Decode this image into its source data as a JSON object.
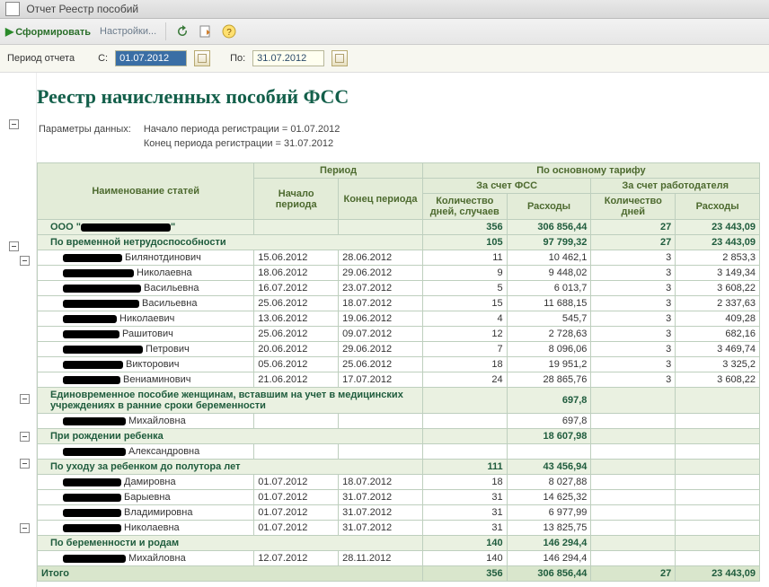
{
  "window": {
    "title": "Отчет  Реестр пособий"
  },
  "toolbar": {
    "generate": "Сформировать",
    "settings": "Настройки..."
  },
  "filter": {
    "period_label": "Период отчета",
    "from_label": "С:",
    "from_value": "01.07.2012",
    "to_label": "По:",
    "to_value": "31.07.2012"
  },
  "header": {
    "title": "Реестр начисленных пособий ФСС",
    "params_label": "Параметры данных:",
    "p1": "Начало периода регистрации = 01.07.2012",
    "p2": "Конец периода регистрации = 31.07.2012"
  },
  "cols": {
    "name": "Наименование статей",
    "period": "Период",
    "start": "Начало периода",
    "end": "Конец периода",
    "main_tariff": "По основному тарифу",
    "fss": "За счет ФСС",
    "employer": "За счет работодателя",
    "days": "Количество дней, случаев",
    "days2": "Количество дней",
    "exp": "Расходы"
  },
  "org_prefix": "ООО \"",
  "org_suffix": "\"",
  "org_total": {
    "fss_days": "356",
    "fss_exp": "306 856,44",
    "emp_days": "27",
    "emp_exp": "23 443,09"
  },
  "cat1": {
    "name": "По временной нетрудоспособности",
    "fss_days": "105",
    "fss_exp": "97 799,32",
    "emp_days": "27",
    "emp_exp": "23 443,09"
  },
  "rows1": [
    {
      "name": " Билянотдинович",
      "start": "15.06.2012",
      "end": "28.06.2012",
      "fd": "11",
      "fe": "10 462,1",
      "ed": "3",
      "ee": "2 853,3"
    },
    {
      "name": " Николаевна",
      "start": "18.06.2012",
      "end": "29.06.2012",
      "fd": "9",
      "fe": "9 448,02",
      "ed": "3",
      "ee": "3 149,34"
    },
    {
      "name": " Васильевна",
      "start": "16.07.2012",
      "end": "23.07.2012",
      "fd": "5",
      "fe": "6 013,7",
      "ed": "3",
      "ee": "3 608,22"
    },
    {
      "name": " Васильевна",
      "start": "25.06.2012",
      "end": "18.07.2012",
      "fd": "15",
      "fe": "11 688,15",
      "ed": "3",
      "ee": "2 337,63"
    },
    {
      "name": " Николаевич",
      "start": "13.06.2012",
      "end": "19.06.2012",
      "fd": "4",
      "fe": "545,7",
      "ed": "3",
      "ee": "409,28"
    },
    {
      "name": " Рашитович",
      "start": "25.06.2012",
      "end": "09.07.2012",
      "fd": "12",
      "fe": "2 728,63",
      "ed": "3",
      "ee": "682,16"
    },
    {
      "name": " Петрович",
      "start": "20.06.2012",
      "end": "29.06.2012",
      "fd": "7",
      "fe": "8 096,06",
      "ed": "3",
      "ee": "3 469,74"
    },
    {
      "name": " Викторович",
      "start": "05.06.2012",
      "end": "25.06.2012",
      "fd": "18",
      "fe": "19 951,2",
      "ed": "3",
      "ee": "3 325,2"
    },
    {
      "name": " Вениаминович",
      "start": "21.06.2012",
      "end": "17.07.2012",
      "fd": "24",
      "fe": "28 865,76",
      "ed": "3",
      "ee": "3 608,22"
    }
  ],
  "cat2": {
    "name": "Единовременное пособие женщинам, вставшим на учет в медицинских учреждениях в ранние сроки беременности",
    "fe": "697,8"
  },
  "rows2": [
    {
      "name": " Михайловна",
      "fe": "697,8"
    }
  ],
  "cat3": {
    "name": "При рождении ребенка",
    "fe": "18 607,98"
  },
  "rows3": [
    {
      "name": " Александровна"
    }
  ],
  "cat4": {
    "name": "По уходу за ребенком до полутора лет",
    "fd": "111",
    "fe": "43 456,94"
  },
  "rows4": [
    {
      "name": " Дамировна",
      "start": "01.07.2012",
      "end": "18.07.2012",
      "fd": "18",
      "fe": "8 027,88"
    },
    {
      "name": " Барыевна",
      "start": "01.07.2012",
      "end": "31.07.2012",
      "fd": "31",
      "fe": "14 625,32"
    },
    {
      "name": " Владимировна",
      "start": "01.07.2012",
      "end": "31.07.2012",
      "fd": "31",
      "fe": "6 977,99"
    },
    {
      "name": " Николаевна",
      "start": "01.07.2012",
      "end": "31.07.2012",
      "fd": "31",
      "fe": "13 825,75"
    }
  ],
  "cat5": {
    "name": "По беременности и родам",
    "fd": "140",
    "fe": "146 294,4"
  },
  "rows5": [
    {
      "name": " Михайловна",
      "start": "12.07.2012",
      "end": "28.11.2012",
      "fd": "140",
      "fe": "146 294,4"
    }
  ],
  "itogo": {
    "label": "Итого",
    "fd": "356",
    "fe": "306 856,44",
    "ed": "27",
    "ee": "23 443,09"
  }
}
